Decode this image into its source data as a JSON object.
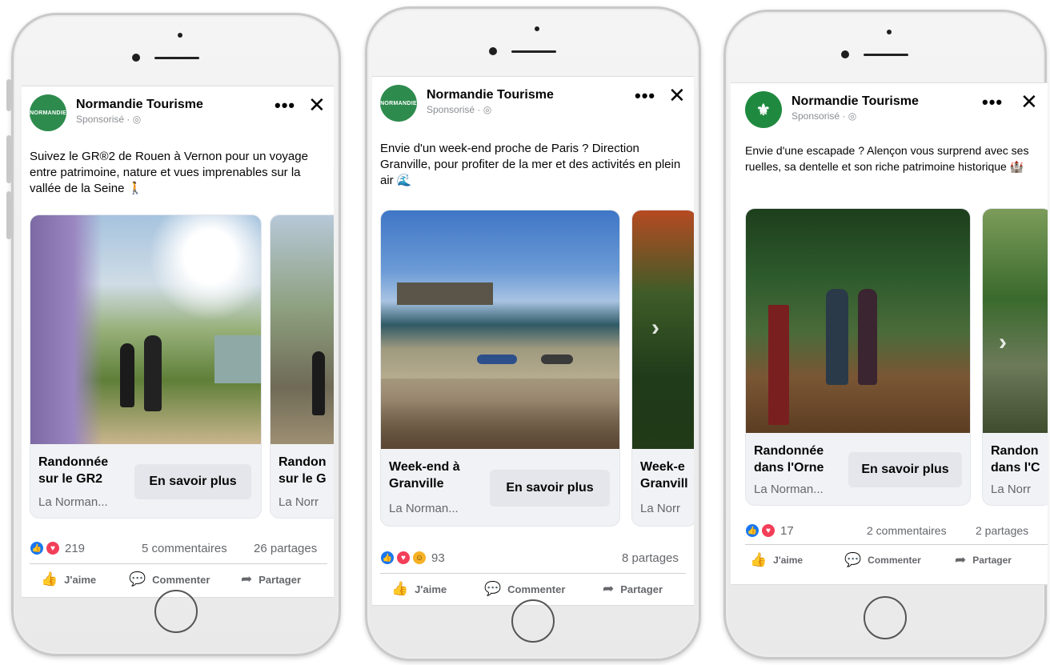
{
  "posts": [
    {
      "page_name": "Normandie Tourisme",
      "sponsored": "Sponsorisé · ",
      "avatar_text": "NORMANDIE",
      "caption": "Suivez le GR®2 de Rouen à Vernon pour un voyage entre patrimoine, nature et vues imprenables sur la vallée de la Seine 🚶",
      "cards": [
        {
          "title": "Randonnée\nsur le GR2",
          "subtitle": "La Norman...",
          "cta": "En savoir plus"
        },
        {
          "title": "Randon\nsur le G",
          "subtitle": "La Norr"
        }
      ],
      "reaction_count": "219",
      "comments": "5 commentaires",
      "shares": "26 partages",
      "actions": {
        "like": "J'aime",
        "comment": "Commenter",
        "share": "Partager"
      }
    },
    {
      "page_name": "Normandie Tourisme",
      "sponsored": "Sponsorisé · ",
      "avatar_text": "NORMANDIE",
      "caption": "Envie d'un week-end proche de Paris ? Direction Granville, pour profiter de la mer et des activités en plein air 🌊",
      "cards": [
        {
          "title": "Week-end à\nGranville",
          "subtitle": "La Norman...",
          "cta": "En savoir plus"
        },
        {
          "title": "Week-e\nGranvill",
          "subtitle": "La Norr"
        }
      ],
      "reaction_count": "93",
      "comments": "",
      "shares": "8 partages",
      "actions": {
        "like": "J'aime",
        "comment": "Commenter",
        "share": "Partager"
      }
    },
    {
      "page_name": "Normandie Tourisme",
      "sponsored": "Sponsorisé · ",
      "avatar_text": "",
      "caption": "Envie d'une escapade ? Alençon vous surprend avec ses ruelles, sa dentelle et son riche patrimoine historique 🏰",
      "cards": [
        {
          "title": "Randonnée\ndans l'Orne",
          "subtitle": "La Norman...",
          "cta": "En savoir plus"
        },
        {
          "title": "Randon\ndans l'C",
          "subtitle": "La Norr"
        }
      ],
      "reaction_count": "17",
      "comments": "2 commentaires",
      "shares": "2 partages",
      "actions": {
        "like": "J'aime",
        "comment": "Commenter",
        "share": "Partager"
      }
    }
  ],
  "icons": {
    "more": "more-options-icon",
    "close": "close-icon",
    "like": "like-icon",
    "comment": "comment-icon",
    "share": "share-icon",
    "globe": "globe-icon",
    "reaction_like": "reaction-like-icon",
    "reaction_love": "reaction-love-icon",
    "reaction_wow": "reaction-wow-icon"
  },
  "colors": {
    "brand_green": "#2e8b4e",
    "like_blue": "#1877f2",
    "love_red": "#f33e58",
    "wow_yellow": "#f7b125",
    "cta_bg": "#e4e6eb"
  }
}
